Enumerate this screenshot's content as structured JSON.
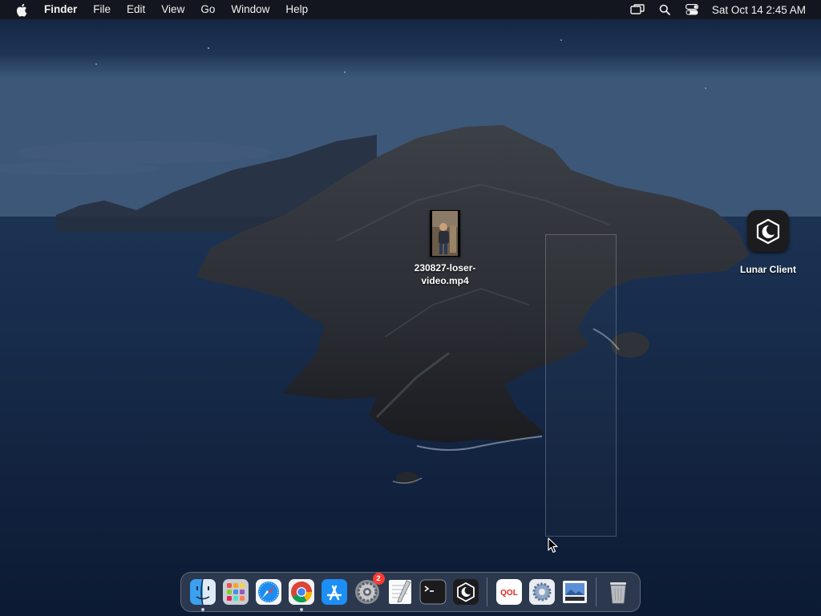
{
  "menubar": {
    "apple_icon": "apple-logo-icon",
    "app_name": "Finder",
    "menus": [
      "File",
      "Edit",
      "View",
      "Go",
      "Window",
      "Help"
    ],
    "status_icons": [
      "screen-mirroring-icon",
      "spotlight-search-icon",
      "control-center-icon"
    ],
    "clock": "Sat Oct 14  2:45 AM"
  },
  "desktop": {
    "file": {
      "label_line1": "230827-loser-",
      "label_line2": "video.mp4",
      "icon": "video-thumbnail-icon"
    },
    "app": {
      "label": "Lunar Client",
      "icon": "lunar-client-icon"
    }
  },
  "dock": {
    "items": [
      {
        "name": "Finder",
        "icon": "finder-icon",
        "running": true
      },
      {
        "name": "Launchpad",
        "icon": "launchpad-icon",
        "running": false
      },
      {
        "name": "Safari",
        "icon": "safari-icon",
        "running": false
      },
      {
        "name": "Google Chrome",
        "icon": "chrome-icon",
        "running": true
      },
      {
        "name": "App Store",
        "icon": "app-store-icon",
        "running": false
      },
      {
        "name": "System Preferences",
        "icon": "system-preferences-icon",
        "running": false,
        "badge": "2"
      },
      {
        "name": "TextEdit",
        "icon": "textedit-icon",
        "running": false
      },
      {
        "name": "Terminal",
        "icon": "terminal-icon",
        "running": false
      },
      {
        "name": "Lunar Client",
        "icon": "lunar-client-icon",
        "running": false
      },
      {
        "name": "QOL",
        "icon": "qol-icon",
        "running": false,
        "text": "QOL"
      },
      {
        "name": "Settings Utility",
        "icon": "gear-icon",
        "running": false
      },
      {
        "name": "Preview",
        "icon": "preview-icon",
        "running": false
      },
      {
        "name": "Trash",
        "icon": "trash-icon",
        "running": false
      }
    ]
  },
  "colors": {
    "menubar_bg": "#14161c",
    "sky_top": "#0f1d3a",
    "sea": "#1b3152",
    "badge": "#ff3b30"
  }
}
